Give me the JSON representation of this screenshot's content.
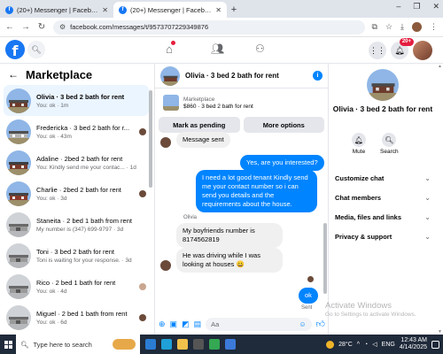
{
  "browser": {
    "tabs": [
      {
        "title": "(20+) Messenger | Facebook",
        "active": false
      },
      {
        "title": "(20+) Messenger | Facebook",
        "active": true
      }
    ],
    "new_tab": "+",
    "url": "facebook.com/messages/t/9573707229349876"
  },
  "fb": {
    "logo": "f",
    "notifications_badge": "20+"
  },
  "marketplace": {
    "title": "Marketplace",
    "conversations": [
      {
        "name": "Olivia · 3 bed 2 bath for rent",
        "sub": "You: ok · 1m",
        "selected": true,
        "thumb": "house"
      },
      {
        "name": "Fredericka · 3 bed 2 bath for r...",
        "sub": "You: ok · 43m",
        "selected": false,
        "thumb": "house"
      },
      {
        "name": "Adaline · 2bed 2 bath for rent",
        "sub": "You: Kindly send me your contac... · 1d",
        "selected": false,
        "thumb": "house"
      },
      {
        "name": "Charlie · 2bed 2 bath for rent",
        "sub": "You: ok · 3d",
        "selected": false,
        "thumb": "house"
      },
      {
        "name": "Staneita · 2 bed 1 bath from rent",
        "sub": "My number is (347) 699-9797 · 3d",
        "selected": false,
        "thumb": "grey"
      },
      {
        "name": "Toni · 3 bed 2 bath for rent",
        "sub": "Toni is waiting for your response. · 3d",
        "selected": false,
        "thumb": "grey"
      },
      {
        "name": "Rico · 2 bed 1 bath for rent",
        "sub": "You: ok · 4d",
        "selected": false,
        "thumb": "grey"
      },
      {
        "name": "Miguel · 2 bed 1 bath from rent",
        "sub": "You: ok · 6d",
        "selected": false,
        "thumb": "grey"
      }
    ]
  },
  "chat": {
    "title": "Olivia · 3 bed 2 bath for rent",
    "listing_label": "Marketplace",
    "listing_price": "$860 · 3 bed 2 bath for rent",
    "btn_pending": "Mark as pending",
    "btn_options": "More options",
    "messages": {
      "m0": "Message sent",
      "m1": "Yes, are you interested?",
      "m2": "I need a lot good tenant Kindly send me your contact number so i can send you details and the requirements about the house.",
      "sender": "Olivia",
      "m3": "My boyfriends number is 8174562819",
      "m4": "He was driving while I was looking at houses 😀",
      "m5": "ok",
      "status": "Sent"
    },
    "composer_placeholder": "Aa"
  },
  "details": {
    "title": "Olivia · 3 bed 2 bath for rent",
    "actions": [
      {
        "label": "Mute"
      },
      {
        "label": "Search"
      }
    ],
    "menu": [
      "Customize chat",
      "Chat members",
      "Media, files and links",
      "Privacy & support"
    ]
  },
  "watermark": {
    "line1": "Activate Windows",
    "line2": "Go to Settings to activate Windows."
  },
  "taskbar": {
    "search_placeholder": "Type here to search",
    "temperature": "28°C",
    "language": "ENG",
    "time": "12:43 AM",
    "date": "4/14/2025"
  },
  "colors": {
    "fb_blue": "#1877f2",
    "messenger_blue": "#0084ff",
    "selected_bg": "#ebf5ff",
    "badge_red": "#e41e3f"
  }
}
